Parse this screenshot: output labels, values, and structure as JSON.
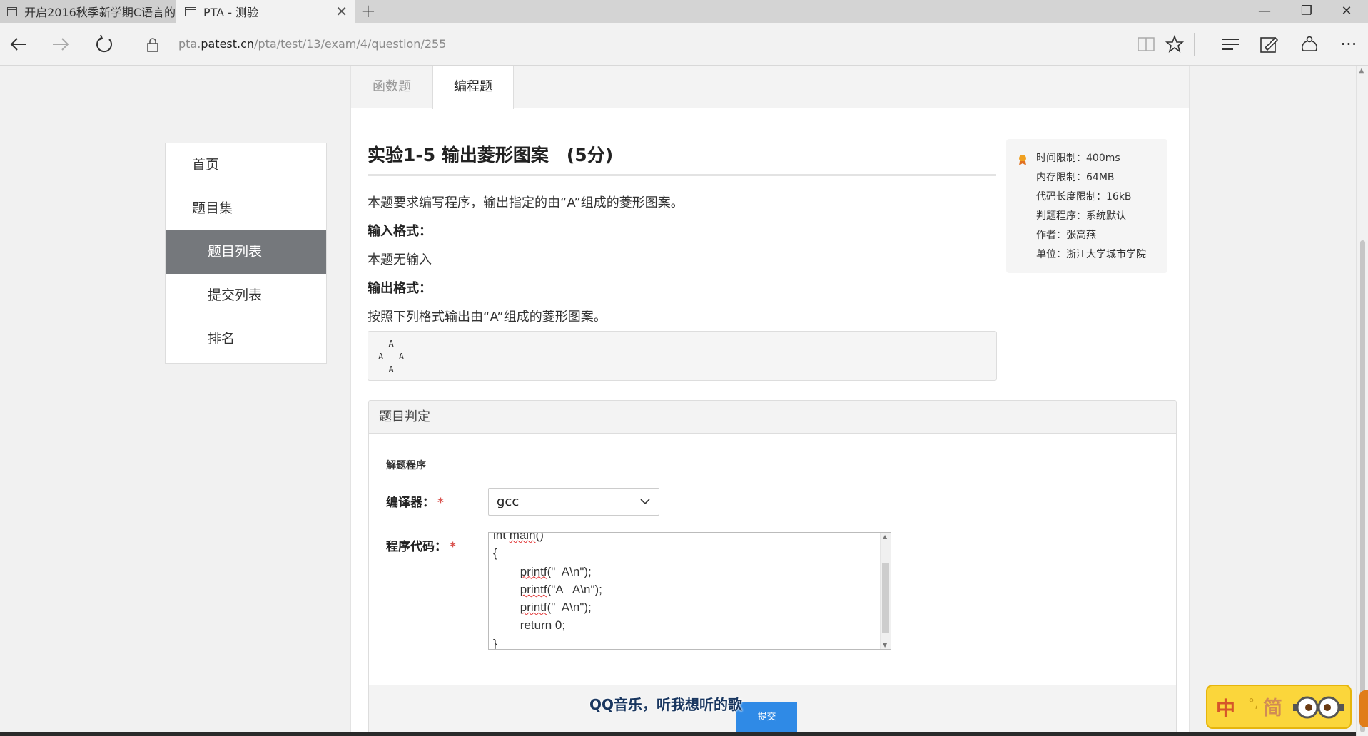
{
  "browser": {
    "tabs": [
      {
        "title": "开启2016秋季新学期C语言的"
      },
      {
        "title": "PTA - 测验"
      }
    ],
    "url_prefix": "pta.",
    "url_domain": "patest.cn",
    "url_path": "/pta/test/13/exam/4/question/255",
    "window_controls": {
      "minimize": "—",
      "restore": "❐",
      "close": "✕"
    }
  },
  "sidebar": {
    "items": [
      {
        "label": "首页"
      },
      {
        "label": "题目集"
      },
      {
        "label": "题目列表"
      },
      {
        "label": "提交列表"
      },
      {
        "label": "排名"
      }
    ],
    "active_index": 2
  },
  "problem_tabs": [
    {
      "label": "函数题"
    },
    {
      "label": "编程题"
    }
  ],
  "problem": {
    "title": "实验1-5 输出菱形图案　(5分)",
    "description": "本题要求编写程序，输出指定的由“A”组成的菱形图案。",
    "input_heading": "输入格式：",
    "input_text": "本题无输入",
    "output_heading": "输出格式：",
    "output_text": "按照下列格式输出由“A”组成的菱形图案。",
    "sample_output": "  A\nA   A\n  A"
  },
  "limits": {
    "time": "时间限制：400ms",
    "memory": "内存限制：64MB",
    "code_length": "代码长度限制：16kB",
    "judge": "判题程序：系统默认",
    "author": "作者：张高燕",
    "unit": "单位：浙江大学城市学院"
  },
  "judge": {
    "header": "题目判定",
    "section_title": "解题程序",
    "compiler_label": "编译器：",
    "compiler_value": "gcc",
    "code_label": "程序代码：",
    "required_mark": "*",
    "code_lines": [
      {
        "pre": "int ",
        "word": "main",
        "post": "()"
      },
      {
        "pre": "{",
        "word": "",
        "post": ""
      },
      {
        "pre": "        ",
        "word": "printf",
        "post": "(\"  A\\n\");"
      },
      {
        "pre": "        ",
        "word": "printf",
        "post": "(\"A   A\\n\");"
      },
      {
        "pre": "        ",
        "word": "printf",
        "post": "(\"  A\\n\");"
      },
      {
        "pre": "        return 0;",
        "word": "",
        "post": ""
      },
      {
        "pre": "}",
        "word": "",
        "post": ""
      }
    ],
    "submit_label": "提交"
  },
  "overlay": {
    "qq_music": "QQ音乐，听我想听的歌",
    "ime_mode": "中",
    "ime_punct": "°,",
    "ime_script": "简"
  },
  "colors": {
    "sidebar_active_bg": "#75787c",
    "submit_bg": "#2f8ae6",
    "required": "#d9534f",
    "ime_bg": "#fbd63b"
  }
}
